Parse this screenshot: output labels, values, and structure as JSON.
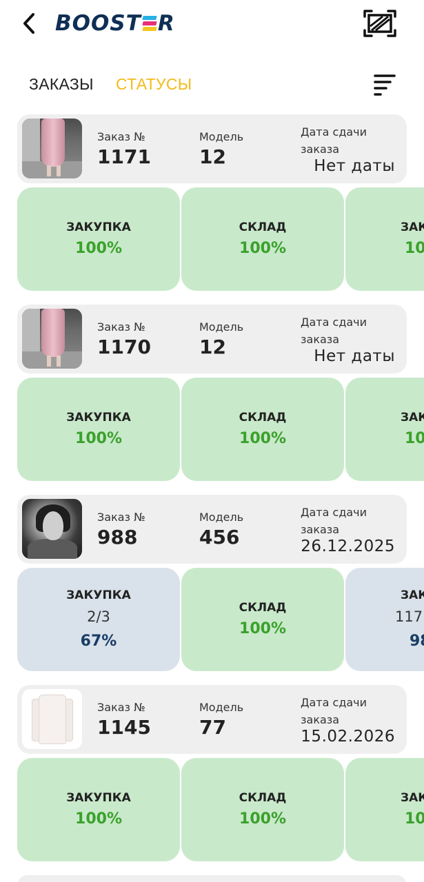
{
  "header": {
    "logo_text": "BOOSTER",
    "back_icon": "chevron-left-icon",
    "scan_icon": "barcode-scan-icon"
  },
  "tabs": {
    "orders_label": "ЗАКАЗЫ",
    "statuses_label": "СТАТУСЫ",
    "filter_icon": "filter-lines-icon"
  },
  "labels": {
    "order_no": "Заказ №",
    "model": "Модель",
    "due_date": "Дата сдачи заказа"
  },
  "colors": {
    "accent_tab": "#f2bb1b",
    "complete_bg": "#c9e9cb",
    "partial_bg": "#d9e2ea",
    "complete_pct": "#3aa12b",
    "partial_pct": "#1a3d66"
  },
  "orders": [
    {
      "order_number": "1171",
      "model": "12",
      "due_date": "Нет даты",
      "statuses": [
        {
          "title": "ЗАКУПКА",
          "fraction": "",
          "percent": "100%"
        },
        {
          "title": "СКЛАД",
          "fraction": "",
          "percent": "100%"
        },
        {
          "title": "ЗАК",
          "fraction": "",
          "percent": "10"
        }
      ]
    },
    {
      "order_number": "1170",
      "model": "12",
      "due_date": "Нет даты",
      "statuses": [
        {
          "title": "ЗАКУПКА",
          "fraction": "",
          "percent": "100%"
        },
        {
          "title": "СКЛАД",
          "fraction": "",
          "percent": "100%"
        },
        {
          "title": "ЗАК",
          "fraction": "",
          "percent": "10"
        }
      ]
    },
    {
      "order_number": "988",
      "model": "456",
      "due_date": "26.12.2025",
      "statuses": [
        {
          "title": "ЗАКУПКА",
          "fraction": "2/3",
          "percent": "67%"
        },
        {
          "title": "СКЛАД",
          "fraction": "",
          "percent": "100%"
        },
        {
          "title": "ЗАК",
          "fraction": "117",
          "percent": "98"
        }
      ]
    },
    {
      "order_number": "1145",
      "model": "77",
      "due_date": "15.02.2026",
      "statuses": [
        {
          "title": "ЗАКУПКА",
          "fraction": "",
          "percent": "100%"
        },
        {
          "title": "СКЛАД",
          "fraction": "",
          "percent": "100%"
        },
        {
          "title": "ЗАК",
          "fraction": "",
          "percent": "10"
        }
      ]
    }
  ]
}
